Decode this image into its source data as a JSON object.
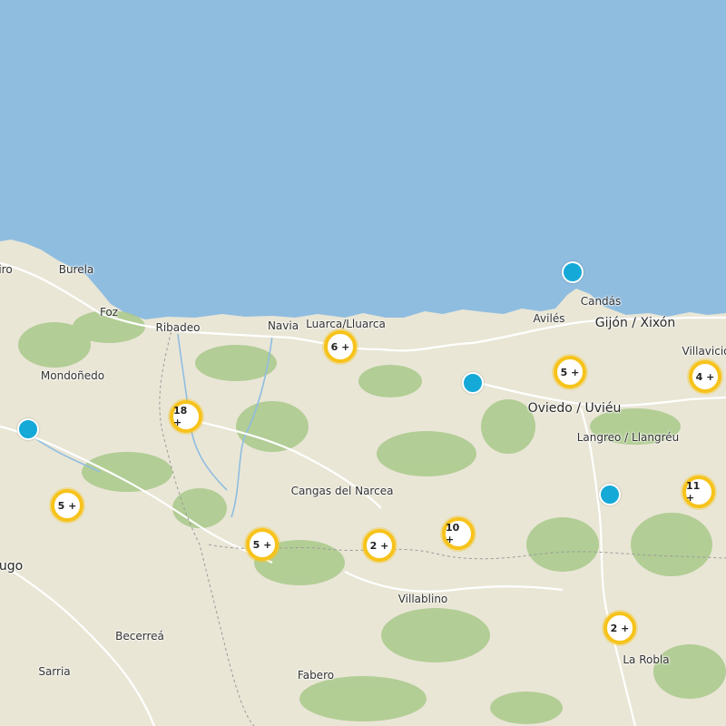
{
  "map": {
    "colors": {
      "sea": "#8fbde0",
      "land": "#e9e6d6",
      "forest": "#a9c98a",
      "road": "#ffffff",
      "border": "#9a9a9a",
      "cluster_ring": "#f7c31b",
      "marker": "#15a9d8"
    },
    "places": [
      {
        "name": "iro"
      },
      {
        "name": "Burela"
      },
      {
        "name": "Foz"
      },
      {
        "name": "Ribadeo"
      },
      {
        "name": "Navia"
      },
      {
        "name": "Luarca/Lluarca"
      },
      {
        "name": "Avilés"
      },
      {
        "name": "Candás"
      },
      {
        "name": "Gijón / Xixón"
      },
      {
        "name": "Villavicio"
      },
      {
        "name": "Mondoñedo"
      },
      {
        "name": "Oviedo / Uviéu"
      },
      {
        "name": "Langreo / Llangréu"
      },
      {
        "name": "Cangas del Narcea"
      },
      {
        "name": "ugo"
      },
      {
        "name": "Villablino"
      },
      {
        "name": "Becerreá"
      },
      {
        "name": "Sarria"
      },
      {
        "name": "Fabero"
      },
      {
        "name": "La Robla"
      }
    ],
    "clusters": [
      {
        "label": "6 +"
      },
      {
        "label": "5 +"
      },
      {
        "label": "4 +"
      },
      {
        "label": "18 +"
      },
      {
        "label": "5 +"
      },
      {
        "label": "5 +"
      },
      {
        "label": "2 +"
      },
      {
        "label": "10 +"
      },
      {
        "label": "11 +"
      },
      {
        "label": "2 +"
      }
    ],
    "markers": [
      {
        "id": "north-coast"
      },
      {
        "id": "central"
      },
      {
        "id": "west"
      },
      {
        "id": "south-east"
      }
    ]
  }
}
